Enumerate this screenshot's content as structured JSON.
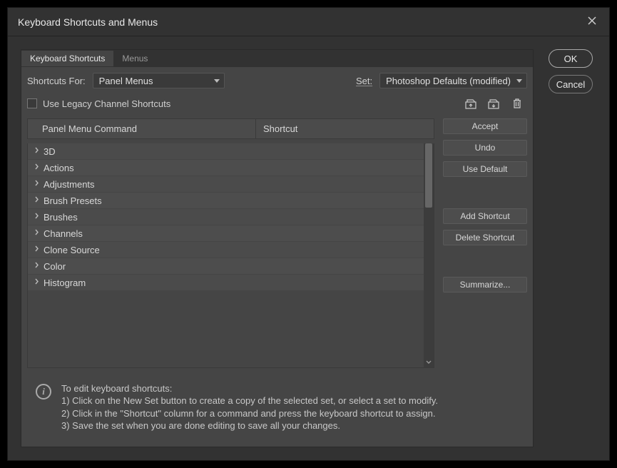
{
  "title": "Keyboard Shortcuts and Menus",
  "tabs": {
    "shortcuts": "Keyboard Shortcuts",
    "menus": "Menus"
  },
  "shortcuts_for_label": "Shortcuts For:",
  "shortcuts_for_value": "Panel Menus",
  "set_label": "Set:",
  "set_value": "Photoshop Defaults (modified)",
  "legacy_label": "Use Legacy Channel Shortcuts",
  "columns": {
    "command": "Panel Menu Command",
    "shortcut": "Shortcut"
  },
  "rows": [
    {
      "label": "3D"
    },
    {
      "label": "Actions"
    },
    {
      "label": "Adjustments"
    },
    {
      "label": "Brush Presets"
    },
    {
      "label": "Brushes"
    },
    {
      "label": "Channels"
    },
    {
      "label": "Clone Source"
    },
    {
      "label": "Color"
    },
    {
      "label": "Histogram"
    }
  ],
  "buttons": {
    "accept": "Accept",
    "undo": "Undo",
    "use_default": "Use Default",
    "add_shortcut": "Add Shortcut",
    "delete_shortcut": "Delete Shortcut",
    "summarize": "Summarize..."
  },
  "dialog_buttons": {
    "ok": "OK",
    "cancel": "Cancel"
  },
  "help": {
    "heading": "To edit keyboard shortcuts:",
    "line1": "1) Click on the New Set button to create a copy of the selected set, or select a set to modify.",
    "line2": "2) Click in the \"Shortcut\" column for a command and press the keyboard shortcut to assign.",
    "line3": "3) Save the set when you are done editing to save all your changes."
  }
}
